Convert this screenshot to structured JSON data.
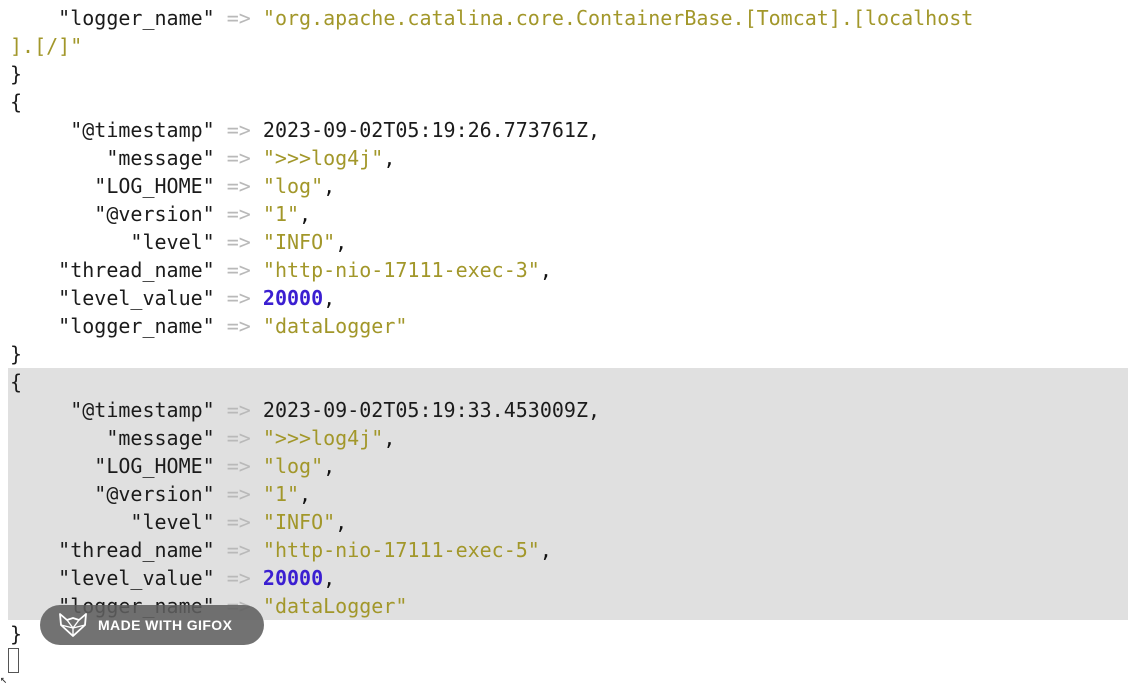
{
  "top": {
    "key": "\"logger_name\"",
    "arrow": "=>",
    "value_line1": "\"org.apache.catalina.core.ContainerBase.[Tomcat].[localhost",
    "value_line2": "].[/]\"",
    "close_brace": "}"
  },
  "entries": [
    {
      "open_brace": "{",
      "timestamp_key": "\"@timestamp\"",
      "timestamp_value": "2023-09-02T05:19:26.773761Z,",
      "message_key": "\"message\"",
      "message_value": "\">>>log4j\"",
      "log_home_key": "\"LOG_HOME\"",
      "log_home_value": "\"log\"",
      "version_key": "\"@version\"",
      "version_value": "\"1\"",
      "level_key": "\"level\"",
      "level_value": "\"INFO\"",
      "thread_key": "\"thread_name\"",
      "thread_value": "\"http-nio-17111-exec-3\"",
      "level_value_key": "\"level_value\"",
      "level_value_num": "20000",
      "logger_key": "\"logger_name\"",
      "logger_value": "\"dataLogger\"",
      "close_brace": "}"
    },
    {
      "open_brace": "{",
      "timestamp_key": "\"@timestamp\"",
      "timestamp_value": "2023-09-02T05:19:33.453009Z,",
      "message_key": "\"message\"",
      "message_value": "\">>>log4j\"",
      "log_home_key": "\"LOG_HOME\"",
      "log_home_value": "\"log\"",
      "version_key": "\"@version\"",
      "version_value": "\"1\"",
      "level_key": "\"level\"",
      "level_value": "\"INFO\"",
      "thread_key": "\"thread_name\"",
      "thread_value": "\"http-nio-17111-exec-5\"",
      "level_value_key": "\"level_value\"",
      "level_value_num": "20000",
      "logger_key": "\"logger_name\"",
      "logger_value": "\"dataLogger\"",
      "close_brace": "}"
    }
  ],
  "punct": {
    "arrow": "=>",
    "comma": ","
  },
  "badge": {
    "text": "MADE WITH GIFOX",
    "icon": "fox-icon"
  },
  "colors": {
    "string": "#a2972a",
    "number": "#3b1fd1",
    "arrow": "#b9b9b9",
    "highlight": "#e0e0e0",
    "badge_bg": "#5f5f5f"
  }
}
